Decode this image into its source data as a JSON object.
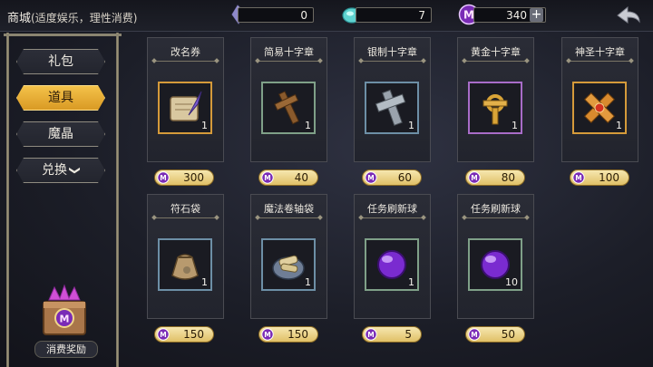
{
  "header": {
    "title": "商城",
    "subtitle": "(适度娱乐，理性消费)",
    "currencies": [
      {
        "icon": "crystal-shard-icon",
        "value": "0"
      },
      {
        "icon": "blue-gem-icon",
        "value": "7"
      },
      {
        "icon": "magic-coin-icon",
        "value": "340"
      }
    ],
    "add_label": "+",
    "back_icon": "back-arrow-icon"
  },
  "sidebar": {
    "items": [
      {
        "label": "礼包",
        "active": false
      },
      {
        "label": "道具",
        "active": true
      },
      {
        "label": "魔晶",
        "active": false
      },
      {
        "label": "兑换",
        "active": false,
        "chevron": "❯"
      }
    ],
    "reward": {
      "label": "消费奖励",
      "icon": "reward-chest-icon"
    }
  },
  "items": [
    {
      "name": "改名券",
      "qty": "1",
      "price": "300",
      "icon": "scroll-quill-icon",
      "frame": "gold"
    },
    {
      "name": "简易十字章",
      "qty": "1",
      "price": "40",
      "icon": "wooden-cross-icon",
      "frame": "green"
    },
    {
      "name": "银制十字章",
      "qty": "1",
      "price": "60",
      "icon": "silver-cross-icon",
      "frame": "blue"
    },
    {
      "name": "黄金十字章",
      "qty": "1",
      "price": "80",
      "icon": "gold-cross-icon",
      "frame": "purple"
    },
    {
      "name": "神圣十字章",
      "qty": "1",
      "price": "100",
      "icon": "holy-cross-icon",
      "frame": "gold"
    },
    {
      "name": "符石袋",
      "qty": "1",
      "price": "150",
      "icon": "rune-bag-icon",
      "frame": "blue"
    },
    {
      "name": "魔法卷轴袋",
      "qty": "1",
      "price": "150",
      "icon": "scroll-bag-icon",
      "frame": "blue"
    },
    {
      "name": "任务刷新球",
      "qty": "1",
      "price": "5",
      "icon": "purple-orb-icon",
      "frame": "green"
    },
    {
      "name": "任务刷新球",
      "qty": "10",
      "price": "50",
      "icon": "purple-orb-icon",
      "frame": "green"
    }
  ],
  "colors": {
    "accent": "#e8b53a",
    "coin": "#8a2bbf",
    "frame": "#7a7566"
  }
}
